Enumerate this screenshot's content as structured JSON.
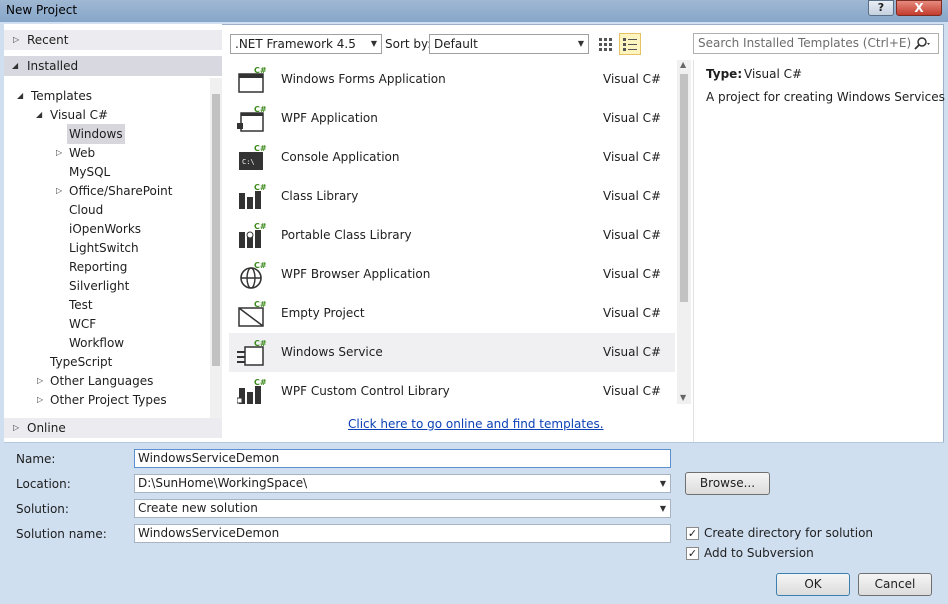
{
  "window": {
    "title": "New Project",
    "help_label": "?",
    "close_label": "X"
  },
  "left_pane": {
    "recent": "Recent",
    "installed": "Installed",
    "templates": "Templates",
    "visual_csharp": "Visual C#",
    "children": [
      "Windows",
      "Web",
      "MySQL",
      "Office/SharePoint",
      "Cloud",
      "iOpenWorks",
      "LightSwitch",
      "Reporting",
      "Silverlight",
      "Test",
      "WCF",
      "Workflow"
    ],
    "typescript": "TypeScript",
    "other_languages": "Other Languages",
    "other_project_types": "Other Project Types",
    "online": "Online"
  },
  "toolbar": {
    "framework": ".NET Framework 4.5",
    "sort_by_label": "Sort by:",
    "sort_value": "Default",
    "search_placeholder": "Search Installed Templates (Ctrl+E)"
  },
  "templates": [
    {
      "name": "Windows Forms Application",
      "lang": "Visual C#",
      "icon": "winforms-icon"
    },
    {
      "name": "WPF Application",
      "lang": "Visual C#",
      "icon": "wpf-icon"
    },
    {
      "name": "Console Application",
      "lang": "Visual C#",
      "icon": "console-icon"
    },
    {
      "name": "Class Library",
      "lang": "Visual C#",
      "icon": "class-library-icon"
    },
    {
      "name": "Portable Class Library",
      "lang": "Visual C#",
      "icon": "portable-class-library-icon"
    },
    {
      "name": "WPF Browser Application",
      "lang": "Visual C#",
      "icon": "globe-icon"
    },
    {
      "name": "Empty Project",
      "lang": "Visual C#",
      "icon": "empty-project-icon"
    },
    {
      "name": "Windows Service",
      "lang": "Visual C#",
      "icon": "windows-service-icon"
    },
    {
      "name": "WPF Custom Control Library",
      "lang": "Visual C#",
      "icon": "custom-control-icon"
    }
  ],
  "online_link": "Click here to go online and find templates.",
  "detail": {
    "type_label": "Type:",
    "type_value": "Visual C#",
    "description": "A project for creating Windows Services"
  },
  "form": {
    "name_label": "Name:",
    "name_value": "WindowsServiceDemon",
    "location_label": "Location:",
    "location_value": "D:\\SunHome\\WorkingSpace\\",
    "solution_label": "Solution:",
    "solution_value": "Create new solution",
    "solution_name_label": "Solution name:",
    "solution_name_value": "WindowsServiceDemon",
    "browse_label": "Browse...",
    "create_dir_label": "Create directory for solution",
    "add_svn_label": "Add to Subversion",
    "ok_label": "OK",
    "cancel_label": "Cancel"
  },
  "colors": {
    "accent": "#0d41b4",
    "titlebar": "#86a6c9",
    "close": "#c43c2c",
    "panel": "#cfdff0"
  }
}
